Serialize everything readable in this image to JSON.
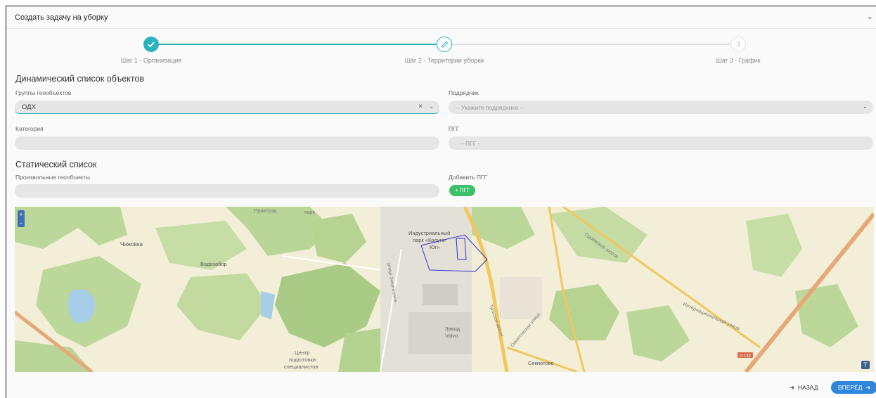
{
  "header": {
    "title": "Создать задачу на уборку",
    "collapse_icon": "chevron-down-icon"
  },
  "stepper": {
    "steps": [
      {
        "label": "Шаг 1 - Организация",
        "state": "done",
        "icon": "check-icon",
        "number": ""
      },
      {
        "label": "Шаг 2 - Территории уборки",
        "state": "active",
        "icon": "pencil-icon",
        "number": ""
      },
      {
        "label": "Шаг 3 - График",
        "state": "pending",
        "icon": "",
        "number": "3"
      }
    ],
    "accent": "#2bb3c0"
  },
  "dynamic": {
    "title": "Динамический список объектов",
    "groups_label": "Группы геообъектов",
    "groups_value": "ОДХ",
    "contractor_label": "Подрядчик",
    "contractor_placeholder": "-- Укажите подрядчика --",
    "category_label": "Категория",
    "category_value": "",
    "pgg_label": "ПГГ",
    "pgg_value": "-- ПГГ -"
  },
  "static": {
    "title": "Статический список",
    "arbitrary_label": "Произвольные геообъекты",
    "arbitrary_value": "",
    "add_pgg_label": "Добавить ПГГ",
    "add_pgg_button": "+ ПГГ"
  },
  "map": {
    "labels": {
      "chizhovka": "Чижовка",
      "vodozabor": "Водозабор",
      "industrial1": "Индустриальный",
      "industrial2": "парк «Калуга-",
      "industrial3": "Юг»",
      "zavod1": "Завод",
      "zavod2": "Volvo",
      "center1": "Центр",
      "center2": "подготовки",
      "center3": "специалистов",
      "sekiotovo": "Секиотово",
      "odoevskoe": "Одоевское шоссе",
      "international": "Интернациональная улица",
      "sekiotovskaya": "Секиотовская улица",
      "tulskoe": "Тульское шоссе",
      "energetikov": "улица Энергетиков",
      "r132": "Р-132",
      "praktrazd": "Практрзд",
      "park": "парк"
    },
    "zoom_in": "+",
    "zoom_out": "-",
    "logo": "T"
  },
  "footer": {
    "back": "НАЗАД",
    "next": "ВПЕРЁД"
  }
}
